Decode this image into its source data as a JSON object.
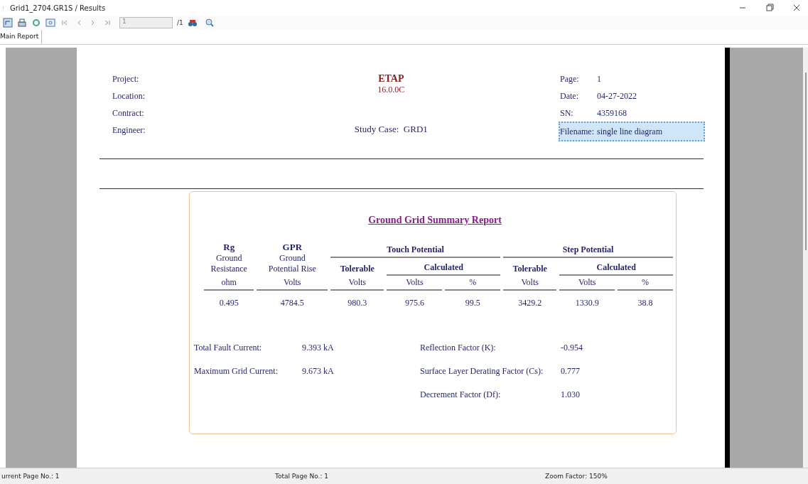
{
  "window": {
    "title": "Grid1_2704.GR1S / Results"
  },
  "toolbar": {
    "page_field": "1",
    "page_total": "/1"
  },
  "tabs": [
    {
      "label": "Main Report",
      "selected": true
    }
  ],
  "report": {
    "header_left": [
      "Project:",
      "Location:",
      "Contract:",
      "Engineer:"
    ],
    "program": "ETAP",
    "version": "16.0.0C",
    "study_case_label": "Study Case:",
    "study_case": "GRD1",
    "header_right": [
      {
        "label": "Page:",
        "value": "1",
        "selected": false
      },
      {
        "label": "Date:",
        "value": "04-27-2022",
        "selected": false
      },
      {
        "label": "SN:",
        "value": "4359168",
        "selected": false
      },
      {
        "label": "Filename:",
        "value": "single line diagram",
        "selected": true
      }
    ],
    "summary": {
      "title": "Ground Grid Summary Report",
      "fixed_columns": [
        {
          "symbol": "Rg",
          "name_lines": [
            "Ground",
            "Resistance"
          ],
          "unit": "ohm"
        },
        {
          "symbol": "GPR",
          "name_lines": [
            "Ground",
            "Potential Rise"
          ],
          "unit": "Volts"
        }
      ],
      "groups": [
        {
          "title": "Touch Potential",
          "tolerable": "Tolerable",
          "tolerable_unit": "Volts",
          "calculated": "Calculated",
          "calculated_units": [
            "Volts",
            "%"
          ]
        },
        {
          "title": "Step Potential",
          "tolerable": "Tolerable",
          "tolerable_unit": "Volts",
          "calculated": "Calculated",
          "calculated_units": [
            "Volts",
            "%"
          ]
        }
      ],
      "values": [
        "0.495",
        "4784.5",
        "980.3",
        "975.6",
        "99.5",
        "3429.2",
        "1330.9",
        "38.8"
      ],
      "left_results": [
        {
          "label": "Total Fault Current:",
          "value": "9.393 kA"
        },
        {
          "label": "Maximum Grid Current:",
          "value": "9.673 kA"
        }
      ],
      "right_results": [
        {
          "label": "Reflection Factor (K):",
          "value": "-0.954"
        },
        {
          "label": "Surface Layer Derating Factor (Cs):",
          "value": "0.777"
        },
        {
          "label": "Decrement Factor (Df):",
          "value": "1.030"
        }
      ]
    }
  },
  "status_bar": [
    "urrent Page No.: 1",
    "Total Page No.: 1",
    "Zoom Factor: 150%"
  ]
}
